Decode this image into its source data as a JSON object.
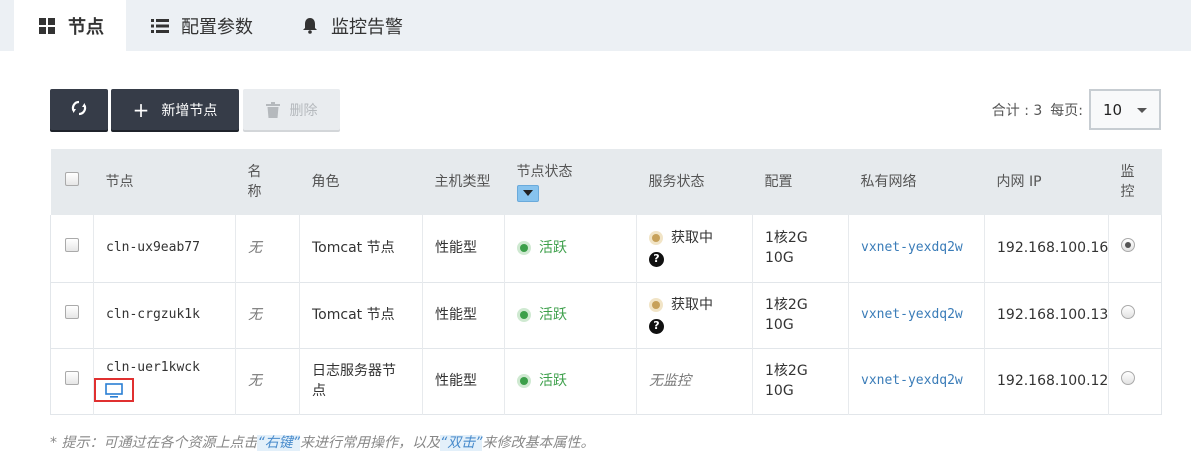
{
  "tabs": [
    {
      "label": "节点",
      "icon": "grid-icon",
      "active": true
    },
    {
      "label": "配置参数",
      "icon": "list-icon",
      "active": false
    },
    {
      "label": "监控告警",
      "icon": "bell-icon",
      "active": false
    }
  ],
  "toolbar": {
    "refresh_icon": "refresh-icon",
    "add_label": "新增节点",
    "delete_label": "删除"
  },
  "pager": {
    "total_label": "合计 : 3",
    "per_page_label": "每页:",
    "per_page_value": "10"
  },
  "table": {
    "headers": [
      "节点",
      "名称",
      "角色",
      "主机类型",
      "节点状态",
      "服务状态",
      "配置",
      "私有网络",
      "内网 IP",
      "监控"
    ],
    "rows": [
      {
        "node": "cln-ux9eab77",
        "name": "无",
        "role": "Tomcat 节点",
        "host_type": "性能型",
        "node_status": "活跃",
        "service_status": "获取中",
        "config": "1核2G 10G",
        "vxnet": "vxnet-yexdq2w",
        "ip": "192.168.100.16",
        "monitor_selected": true
      },
      {
        "node": "cln-crgzuk1k",
        "name": "无",
        "role": "Tomcat 节点",
        "host_type": "性能型",
        "node_status": "活跃",
        "service_status": "获取中",
        "config": "1核2G 10G",
        "vxnet": "vxnet-yexdq2w",
        "ip": "192.168.100.13",
        "monitor_selected": false
      },
      {
        "node": "cln-uer1kwck",
        "name": "无",
        "role": "日志服务器节点",
        "host_type": "性能型",
        "node_status": "活跃",
        "service_status": "无监控",
        "config": "1核2G 10G",
        "vxnet": "vxnet-yexdq2w",
        "ip": "192.168.100.12",
        "monitor_selected": false
      }
    ]
  },
  "footer": {
    "prefix": "* 提示：可通过在各个资源上点击",
    "right_click": "“右键”",
    "middle": "来进行常用操作，以及",
    "double_click": "“双击”",
    "suffix": "来修改基本属性。"
  },
  "colors": {
    "dark_button": "#363c48",
    "active_green": "#3c9f4a",
    "link_blue": "#3a7cb8",
    "tab_bar": "#ecf0f4"
  }
}
